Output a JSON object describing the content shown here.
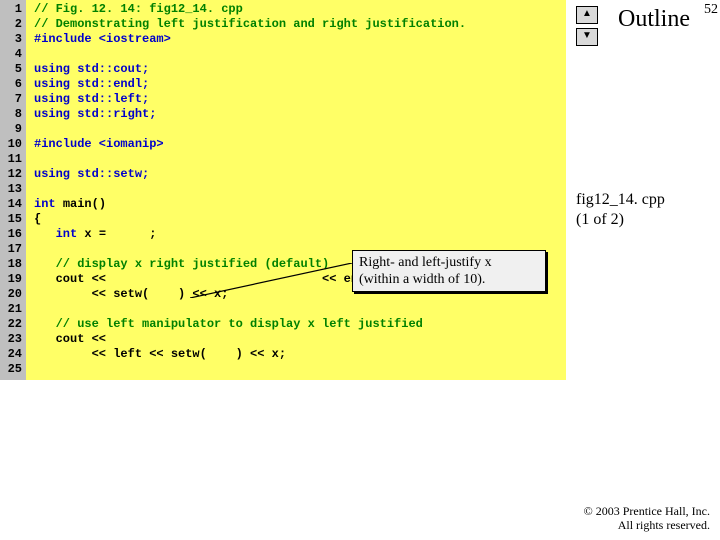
{
  "slide_number": "52",
  "outline_label": "Outline",
  "nav": {
    "up_glyph": "▲",
    "down_glyph": "▼"
  },
  "caption": {
    "line1": "fig12_14. cpp",
    "line2": "(1 of 2)"
  },
  "code": {
    "line_count": 25,
    "lines": [
      {
        "n": 1,
        "type": "cmt",
        "text": "// Fig. 12. 14: fig12_14. cpp"
      },
      {
        "n": 2,
        "type": "cmt",
        "text": "// Demonstrating left justification and right justification."
      },
      {
        "n": 3,
        "type": "pp",
        "text": "#include <iostream>"
      },
      {
        "n": 4,
        "type": "",
        "text": ""
      },
      {
        "n": 5,
        "type": "kw",
        "text": "using std::cout;"
      },
      {
        "n": 6,
        "type": "kw",
        "text": "using std::endl;"
      },
      {
        "n": 7,
        "type": "kw",
        "text": "using std::left;"
      },
      {
        "n": 8,
        "type": "kw",
        "text": "using std::right;"
      },
      {
        "n": 9,
        "type": "",
        "text": ""
      },
      {
        "n": 10,
        "type": "pp",
        "text": "#include <iomanip>"
      },
      {
        "n": 11,
        "type": "",
        "text": ""
      },
      {
        "n": 12,
        "type": "kw",
        "text": "using std::setw;"
      },
      {
        "n": 13,
        "type": "",
        "text": ""
      },
      {
        "n": 14,
        "type": "mix",
        "kw": "int ",
        "rest": "main()"
      },
      {
        "n": 15,
        "type": "",
        "text": "{"
      },
      {
        "n": 16,
        "type": "mix2",
        "indent": "   ",
        "kw": "int ",
        "rest": "x =      ;"
      },
      {
        "n": 17,
        "type": "",
        "text": ""
      },
      {
        "n": 18,
        "type": "cmt",
        "text": "   // display x right justified (default)"
      },
      {
        "n": 19,
        "type": "",
        "text": "   cout <<                              << endl"
      },
      {
        "n": 20,
        "type": "",
        "text": "        << setw(    ) << x;"
      },
      {
        "n": 21,
        "type": "",
        "text": ""
      },
      {
        "n": 22,
        "type": "cmt",
        "text": "   // use left manipulator to display x left justified"
      },
      {
        "n": 23,
        "type": "",
        "text": "   cout <<"
      },
      {
        "n": 24,
        "type": "",
        "text": "        << left << setw(    ) << x;"
      },
      {
        "n": 25,
        "type": "",
        "text": ""
      }
    ]
  },
  "callout": {
    "line1": "Right- and left-justify x",
    "line2": "(within a width of 10)."
  },
  "copyright": {
    "line1": "© 2003 Prentice Hall, Inc.",
    "line2": "All rights reserved."
  }
}
